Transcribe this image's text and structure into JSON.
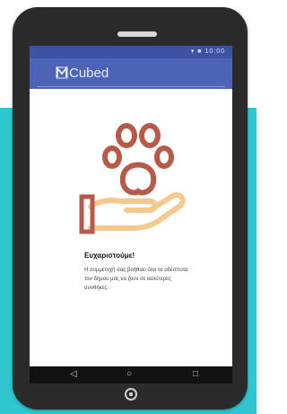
{
  "app": {
    "title": "Cubed",
    "logo_icon": "m-logo-icon"
  },
  "status_bar": {
    "icons": "▾ ■ 10:00"
  },
  "message": {
    "title": "Ευχαριστούμε!",
    "body": "Η συμμετοχή σας βοήθαει όλα τα αδέσποτα του δήμου μας να ζουν σε καλύτερες συνθήκες."
  },
  "nav": {
    "back_icon": "◁",
    "home_icon": "○",
    "recent_icon": "□"
  },
  "colors": {
    "brand": "#4d63b8",
    "status_bar": "#3d52a3",
    "background_band": "#2ec7cf",
    "paw": "#b85a4a",
    "hand": "#f6c88d"
  }
}
